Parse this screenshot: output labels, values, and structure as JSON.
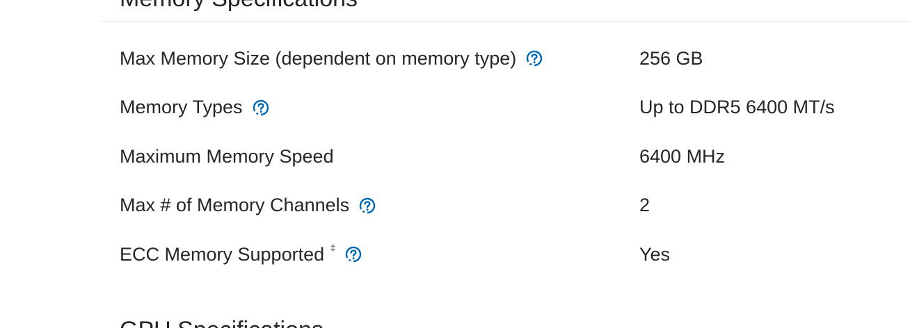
{
  "sections": {
    "memory_title": "Memory Specifications",
    "next_title": "GPU Specifications"
  },
  "memory_specs": [
    {
      "label": "Max Memory Size (dependent on memory type)",
      "value": "256 GB",
      "has_help": true,
      "footnote": ""
    },
    {
      "label": "Memory Types",
      "value": "Up to DDR5 6400 MT/s",
      "has_help": true,
      "footnote": ""
    },
    {
      "label": "Maximum Memory Speed",
      "value": "6400 MHz",
      "has_help": false,
      "footnote": ""
    },
    {
      "label": "Max # of Memory Channels",
      "value": "2",
      "has_help": true,
      "footnote": ""
    },
    {
      "label": "ECC Memory Supported",
      "value": "Yes",
      "has_help": true,
      "footnote": "‡"
    }
  ],
  "icons": {
    "help": "help-circle-icon"
  },
  "colors": {
    "text": "#262626",
    "help_icon": "#0068b5",
    "divider": "#e2e2e2"
  }
}
